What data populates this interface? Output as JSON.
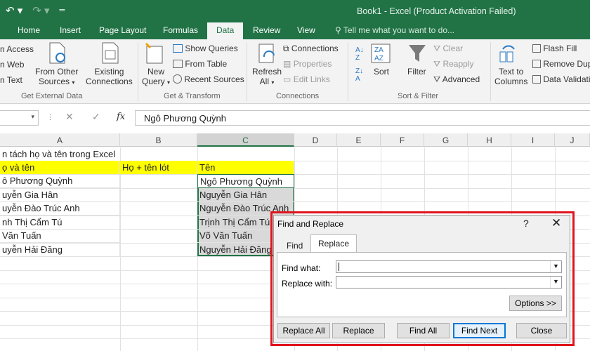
{
  "window": {
    "title": "Book1 - Excel (Product Activation Failed)"
  },
  "quick_access": {
    "undo_icon": "undo-icon",
    "redo_icon": "redo-icon",
    "customize_icon": "customize-icon"
  },
  "tabs": [
    {
      "label": "Home"
    },
    {
      "label": "Insert"
    },
    {
      "label": "Page Layout"
    },
    {
      "label": "Formulas"
    },
    {
      "label": "Data"
    },
    {
      "label": "Review"
    },
    {
      "label": "View"
    }
  ],
  "tell_me": "Tell me what you want to do...",
  "ribbon": {
    "get_external": {
      "access": "n Access",
      "web": "n Web",
      "text": "n Text",
      "from_other_1": "From Other",
      "from_other_2": "Sources",
      "existing_1": "Existing",
      "existing_2": "Connections",
      "group": "Get External Data"
    },
    "get_transform": {
      "new_query_1": "New",
      "new_query_2": "Query",
      "show_queries": "Show Queries",
      "from_table": "From Table",
      "recent_sources": "Recent Sources",
      "group": "Get & Transform"
    },
    "connections": {
      "refresh_1": "Refresh",
      "refresh_2": "All",
      "connections": "Connections",
      "properties": "Properties",
      "edit_links": "Edit Links",
      "group": "Connections"
    },
    "sort_filter": {
      "sort": "Sort",
      "filter": "Filter",
      "clear": "Clear",
      "reapply": "Reapply",
      "advanced": "Advanced",
      "group": "Sort & Filter"
    },
    "data_tools": {
      "text_to_1": "Text to",
      "text_to_2": "Columns",
      "flash_fill": "Flash Fill",
      "remove_dup": "Remove Dup",
      "data_valid": "Data Validati"
    }
  },
  "formula_bar": {
    "fx": "fx",
    "content": "Ngô Phương Quỳnh"
  },
  "columns": [
    "A",
    "B",
    "C",
    "D",
    "E",
    "F",
    "G",
    "H",
    "I",
    "J"
  ],
  "cells": {
    "a1": "n tách họ và tên trong Excel",
    "a2": "ọ và tên",
    "b2": "Họ + tên lót",
    "c2": "Tên",
    "rows": [
      {
        "a": "ô Phương Quỳnh",
        "c": "Ngô Phương Quỳnh"
      },
      {
        "a": "uyễn Gia Hân",
        "c": "Nguyễn Gia Hân"
      },
      {
        "a": "uyễn Đào Trúc Anh",
        "c": "Nguyễn Đào Trúc Anh"
      },
      {
        "a": "nh Thị Cẩm Tú",
        "c": "Trịnh Thị Cẩm Tú"
      },
      {
        "a": "Văn Tuấn",
        "c": "Võ Văn Tuấn"
      },
      {
        "a": "uyễn Hải Đăng",
        "c": "Nguyễn Hải Đăng"
      }
    ],
    "highlight_color": "#ffff00",
    "selection_color": "#d9d9d9"
  },
  "dialog": {
    "title": "Find and Replace",
    "help": "?",
    "close": "✕",
    "tab_find": "Find",
    "tab_replace": "Replace",
    "find_what_label": "Find what:",
    "replace_with_label": "Replace with:",
    "find_what_value": "",
    "replace_with_value": "",
    "options": "Options >>",
    "replace_all": "Replace All",
    "replace": "Replace",
    "find_all": "Find All",
    "find_next": "Find Next",
    "close_button": "Close"
  },
  "colors": {
    "brand": "#217346",
    "dialog_frame": "#e0141e",
    "default_button": "#0078d7"
  }
}
